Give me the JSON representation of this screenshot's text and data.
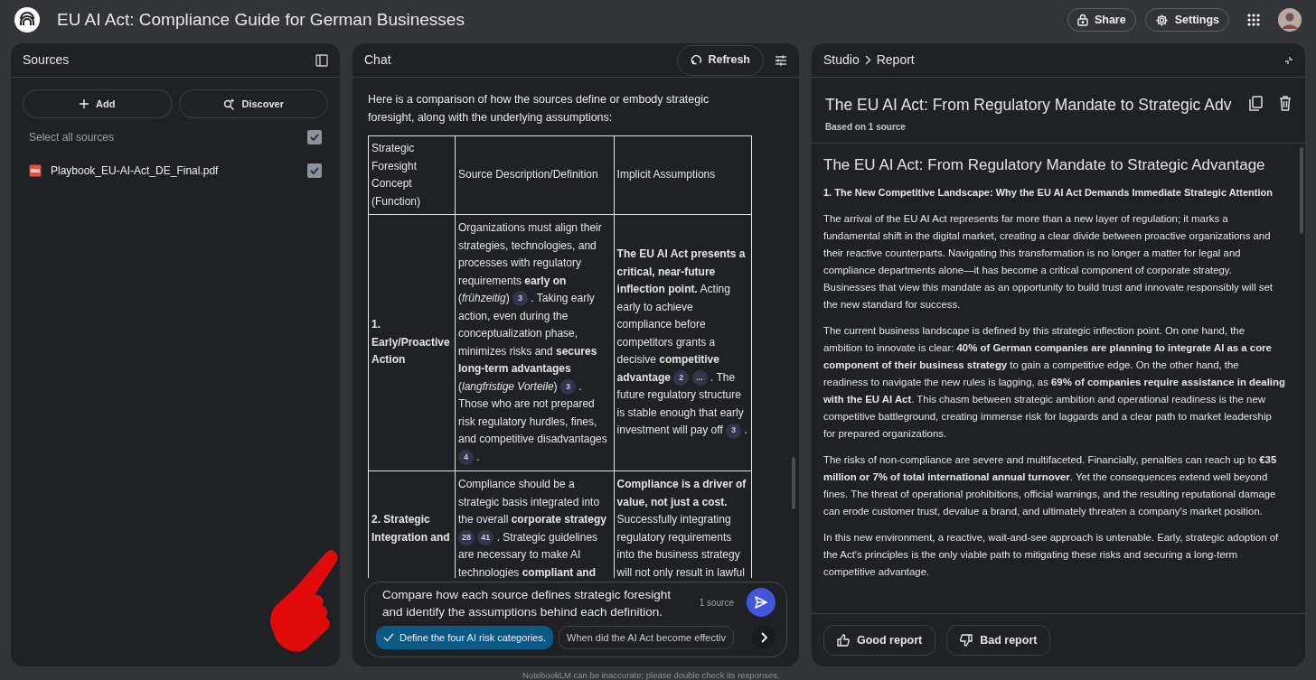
{
  "app": {
    "title": "EU AI Act: Compliance Guide for German Businesses"
  },
  "top_actions": [
    {
      "label": "Share",
      "kind": "share"
    },
    {
      "label": "Settings",
      "kind": "settings"
    }
  ],
  "sources": {
    "title": "Sources",
    "buttons": [
      {
        "label": "Add",
        "kind": "add"
      },
      {
        "label": "Discover",
        "kind": "discover"
      }
    ],
    "select_all": {
      "label": "Select all sources",
      "checked": true
    },
    "items": [
      {
        "name": "Playbook_EU-AI-Act_DE_Final.pdf",
        "checked": true
      }
    ]
  },
  "chat": {
    "title": "Chat",
    "refresh": "Refresh",
    "intro": "Here is a comparison of how the sources define or embody strategic foresight, along with the underlying assumptions:",
    "table": {
      "columns": [
        "Strategic Foresight Concept (Function)",
        "Source Description/Definition",
        "Implicit Assumptions"
      ],
      "rows": [
        [
          [
            {
              "kind": "text",
              "text": "**1. Early/Proactive Action**"
            }
          ],
          [
            {
              "kind": "text",
              "text": "Organizations must align their strategies, technologies, and processes with regulatory requirements **early on** (*frühzeitig*)"
            },
            {
              "kind": "cite",
              "text": "3"
            },
            {
              "kind": "text",
              "text": ". Taking early action, even during the conceptualization phase, minimizes risks and **secures long-term advantages** (*langfristige Vorteile*)"
            },
            {
              "kind": "cite",
              "text": "3"
            },
            {
              "kind": "text",
              "text": ". Those who are not prepared risk regulatory hurdles, fines, and competitive disadvantages"
            },
            {
              "kind": "cite",
              "text": "4"
            },
            {
              "kind": "text",
              "text": "."
            }
          ],
          [
            {
              "kind": "text",
              "text": "**The EU AI Act presents a critical, near-future inflection point.** Acting early to achieve compliance before competitors grants a decisive **competitive advantage**"
            },
            {
              "kind": "cite",
              "text": "2"
            },
            {
              "kind": "cite",
              "text": "..."
            },
            {
              "kind": "text",
              "text": ". The future regulatory structure is stable enough that early investment will pay off"
            },
            {
              "kind": "cite",
              "text": "3"
            },
            {
              "kind": "text",
              "text": "."
            }
          ]
        ],
        [
          [
            {
              "kind": "text",
              "text": "**2. Strategic Integration and**"
            }
          ],
          [
            {
              "kind": "text",
              "text": "Compliance should be a strategic basis integrated into the overall **corporate strategy**"
            },
            {
              "kind": "cite",
              "text": "28"
            },
            {
              "kind": "cite",
              "text": "41"
            },
            {
              "kind": "text",
              "text": ". Strategic guidelines are necessary to make AI technologies **compliant and**"
            }
          ],
          [
            {
              "kind": "text",
              "text": "**Compliance is a driver of value, not just a cost.** Successfully integrating regulatory requirements into the business strategy will not only result in lawful"
            }
          ]
        ]
      ]
    },
    "input": {
      "value": "Compare how each source defines strategic foresight and identify the assumptions behind each definition.",
      "source_count": "1 source"
    },
    "suggestions": [
      {
        "label": "Define the four AI risk categories.",
        "selected": true
      },
      {
        "label": "When did the AI Act become effectiv",
        "selected": false
      }
    ]
  },
  "studio": {
    "breadcrumb": [
      "Studio",
      "Report"
    ],
    "report_title": "The EU AI Act: From Regulatory Mandate to Strategic Adv",
    "subtitle": "Based on 1 source",
    "heading": "The EU AI Act: From Regulatory Mandate to Strategic Advantage",
    "section": "1. The New Competitive Landscape: Why the EU AI Act Demands Immediate Strategic Attention",
    "paragraphs": [
      "The arrival of the EU AI Act represents far more than a new layer of regulation; it marks a fundamental shift in the digital market, creating a clear divide between proactive organizations and their reactive counterparts. Navigating this transformation is no longer a matter for legal and compliance departments alone—it has become a critical component of corporate strategy. Businesses that view this mandate as an opportunity to build trust and innovate responsibly will set the new standard for success.",
      "The current business landscape is defined by this strategic inflection point. On one hand, the ambition to innovate is clear: **40% of German companies are planning to integrate AI as a core component of their business strategy** to gain a competitive edge. On the other hand, the readiness to navigate the new rules is lagging, as **69% of companies require assistance in dealing with the EU AI Act**. This chasm between strategic ambition and operational readiness is the new competitive battleground, creating immense risk for laggards and a clear path to market leadership for prepared organizations.",
      "The risks of non-compliance are severe and multifaceted. Financially, penalties can reach up to **€35 million or 7% of total international annual turnover**. Yet the consequences extend well beyond fines. The threat of operational prohibitions, official warnings, and the resulting reputational damage can erode customer trust, devalue a brand, and ultimately threaten a company's market position.",
      "In this new environment, a reactive, wait-and-see approach is untenable. Early, strategic adoption of the Act's principles is the only viable path to mitigating these risks and securing a long-term competitive advantage."
    ],
    "feedback": [
      {
        "label": "Good report",
        "kind": "up"
      },
      {
        "label": "Bad report",
        "kind": "down"
      }
    ]
  },
  "disclaimer": "NotebookLM can be inaccurate; please double check its responses."
}
